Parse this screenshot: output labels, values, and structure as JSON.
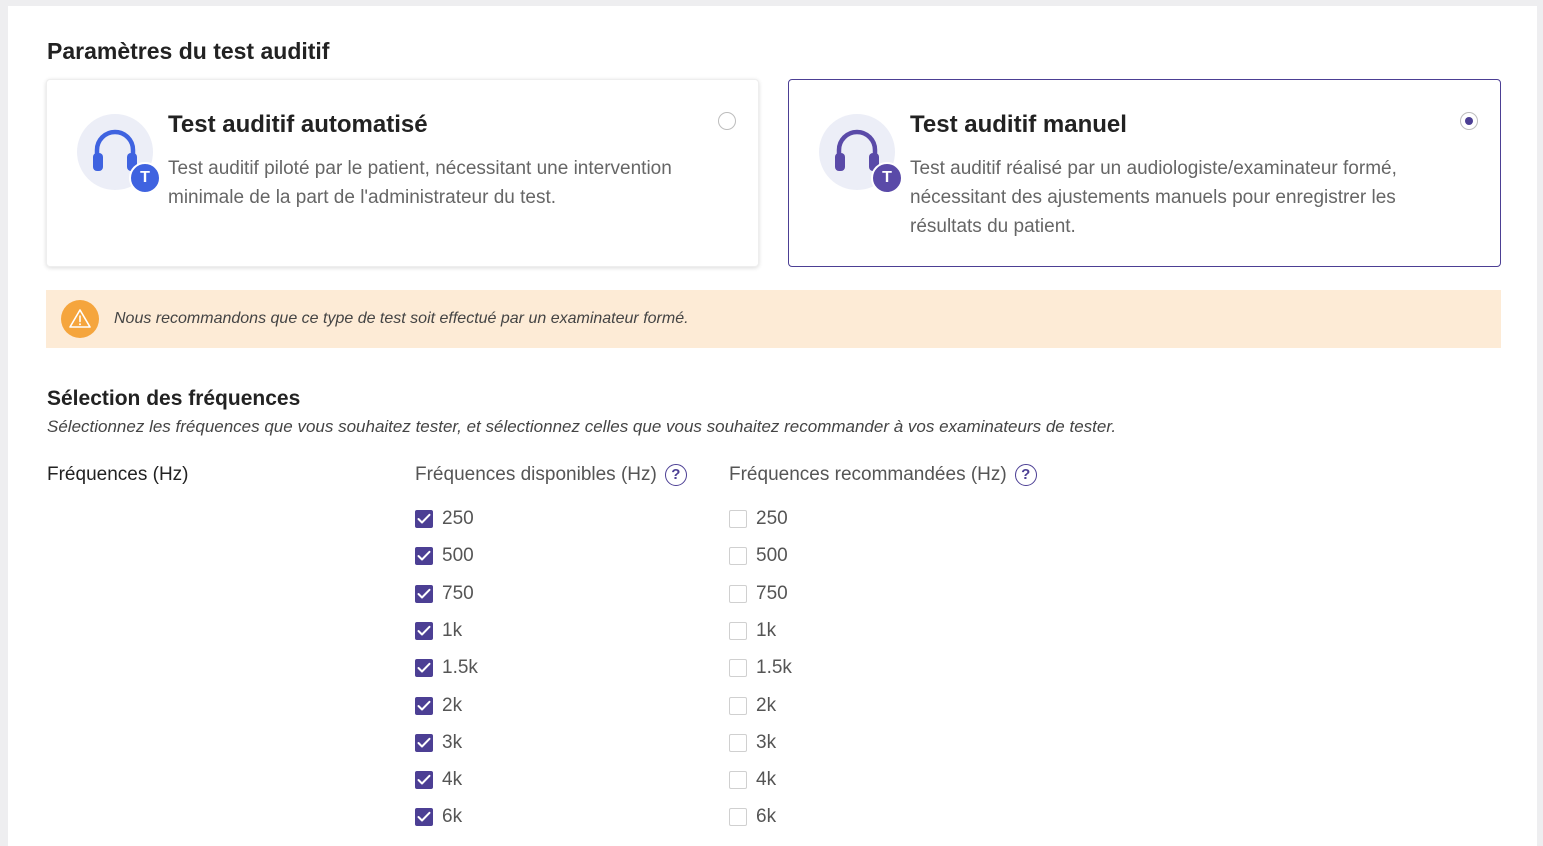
{
  "page": {
    "title": "Paramètres du test auditif"
  },
  "cards": {
    "automated": {
      "title": "Test auditif automatisé",
      "description": "Test auditif piloté par le patient, nécessitant une intervention minimale de la part de l'administrateur du test.",
      "badge": "T",
      "selected": false
    },
    "manual": {
      "title": "Test auditif manuel",
      "description": "Test auditif réalisé par un audiologiste/examinateur formé, nécessitant des ajustements manuels pour enregistrer les résultats du patient.",
      "badge": "T",
      "selected": true
    }
  },
  "warning": {
    "text": "Nous recommandons que ce type de test soit effectué par un examinateur formé."
  },
  "frequencies": {
    "heading": "Sélection des fréquences",
    "subtitle": "Sélectionnez les fréquences que vous souhaitez tester, et sélectionnez celles que vous souhaitez recommander à vos examinateurs de tester.",
    "label": "Fréquences (Hz)",
    "available": {
      "header": "Fréquences disponibles (Hz)",
      "help": "?",
      "items": [
        {
          "label": "250",
          "checked": true
        },
        {
          "label": "500",
          "checked": true
        },
        {
          "label": "750",
          "checked": true
        },
        {
          "label": "1k",
          "checked": true
        },
        {
          "label": "1.5k",
          "checked": true
        },
        {
          "label": "2k",
          "checked": true
        },
        {
          "label": "3k",
          "checked": true
        },
        {
          "label": "4k",
          "checked": true
        },
        {
          "label": "6k",
          "checked": true
        }
      ]
    },
    "recommended": {
      "header": "Fréquences recommandées (Hz)",
      "help": "?",
      "items": [
        {
          "label": "250",
          "checked": false
        },
        {
          "label": "500",
          "checked": false
        },
        {
          "label": "750",
          "checked": false
        },
        {
          "label": "1k",
          "checked": false
        },
        {
          "label": "1.5k",
          "checked": false
        },
        {
          "label": "2k",
          "checked": false
        },
        {
          "label": "3k",
          "checked": false
        },
        {
          "label": "4k",
          "checked": false
        },
        {
          "label": "6k",
          "checked": false
        }
      ]
    }
  },
  "colors": {
    "accent": "#4c3f94",
    "automated_icon": "#3f63e0",
    "manual_icon": "#5a4aa8",
    "warning_bg": "#fdebd6",
    "warning_icon": "#f5a53d"
  }
}
